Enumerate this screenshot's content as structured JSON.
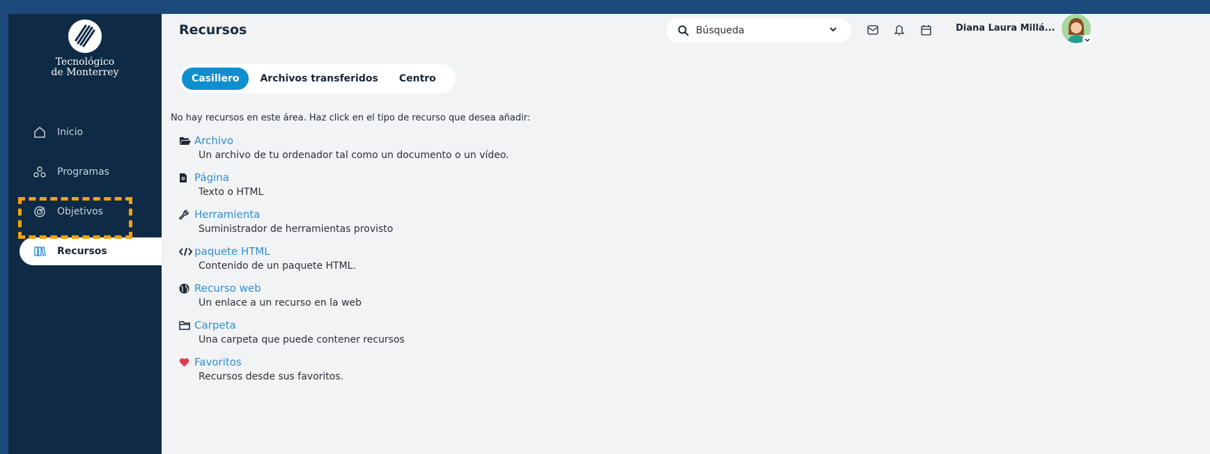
{
  "sidebar": {
    "logo_line1": "Tecnológico",
    "logo_line2": "de Monterrey",
    "items": [
      {
        "label": "Inicio",
        "icon": "home-icon"
      },
      {
        "label": "Programas",
        "icon": "programs-icon"
      },
      {
        "label": "Objetivos",
        "icon": "target-icon"
      },
      {
        "label": "Recursos",
        "icon": "books-icon",
        "active": true
      }
    ]
  },
  "header": {
    "title": "Recursos",
    "search_placeholder": "Búsqueda",
    "user_name": "Diana Laura Millá..."
  },
  "tabs": [
    {
      "label": "Casillero",
      "active": true
    },
    {
      "label": "Archivos transferidos"
    },
    {
      "label": "Centro"
    }
  ],
  "content": {
    "intro": "No hay recursos en este área. Haz click en el tipo de recurso que desea añadir:",
    "resources": [
      {
        "label": "Archivo",
        "desc": "Un archivo de tu ordenador tal como un documento o un vídeo.",
        "icon": "folder-open-icon"
      },
      {
        "label": "Página",
        "desc": "Texto o HTML",
        "icon": "file-text-icon"
      },
      {
        "label": "Herramienta",
        "desc": "Suministrador de herramientas provisto",
        "icon": "wrench-icon"
      },
      {
        "label": "paquete HTML",
        "desc": "Contenido de un paquete HTML.",
        "icon": "code-icon"
      },
      {
        "label": "Recurso web",
        "desc": "Un enlace a un recurso en la web",
        "icon": "globe-icon"
      },
      {
        "label": "Carpeta",
        "desc": "Una carpeta que puede contener recursos",
        "icon": "folder-icon"
      },
      {
        "label": "Favoritos",
        "desc": "Recursos desde sus favoritos.",
        "icon": "heart-icon"
      }
    ]
  },
  "colors": {
    "sidebar_bg": "#0f2a44",
    "accent": "#0e8fd0",
    "link": "#2d8fd0",
    "highlight": "#f2a20c",
    "heart": "#e0394a"
  }
}
